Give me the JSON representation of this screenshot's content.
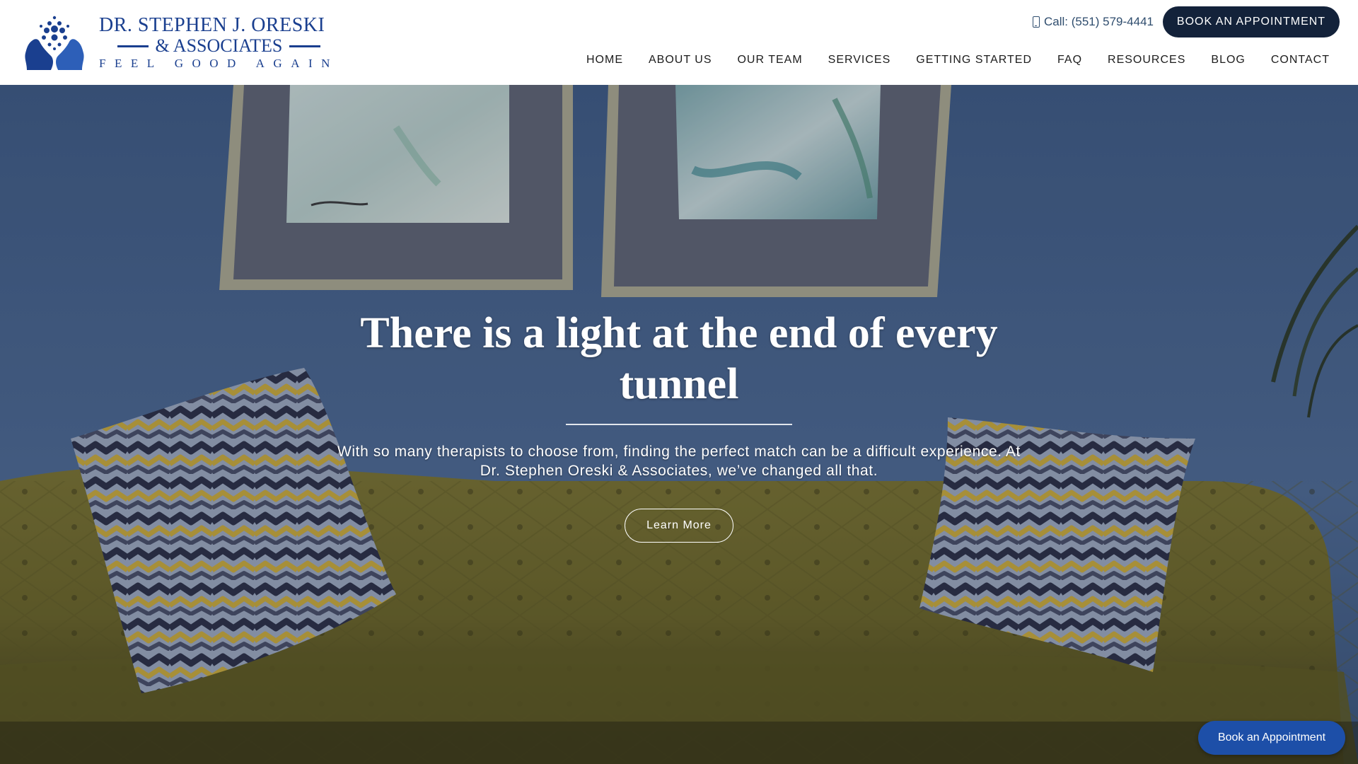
{
  "header": {
    "logo": {
      "line1": "DR. STEPHEN J. ORESKI",
      "line2": "& ASSOCIATES",
      "tagline": "FEEL GOOD AGAIN",
      "icon": "head-profile-dots-logo"
    },
    "call_text": "Call: (551) 579-4441",
    "phone_icon": "mobile-phone-icon",
    "book_button": "BOOK AN APPOINTMENT",
    "nav": [
      {
        "label": "HOME"
      },
      {
        "label": "ABOUT US"
      },
      {
        "label": "OUR TEAM"
      },
      {
        "label": "SERVICES"
      },
      {
        "label": "GETTING STARTED"
      },
      {
        "label": "FAQ"
      },
      {
        "label": "RESOURCES"
      },
      {
        "label": "BLOG"
      },
      {
        "label": "CONTACT"
      }
    ]
  },
  "hero": {
    "title": "There is a light at the end of every tunnel",
    "subtitle": "With so many therapists to choose from, finding the perfect match can be a difficult experience. At Dr. Stephen Oreski & Associates, we’ve changed all that.",
    "button": "Learn More"
  },
  "floating_button": "Book an Appointment",
  "colors": {
    "brand_blue": "#1a3f8f",
    "dark_navy_button": "#13223a",
    "float_button_blue": "#1d4fa8",
    "wall_blue": "#4a6488",
    "sofa_olive": "#6b6524"
  }
}
